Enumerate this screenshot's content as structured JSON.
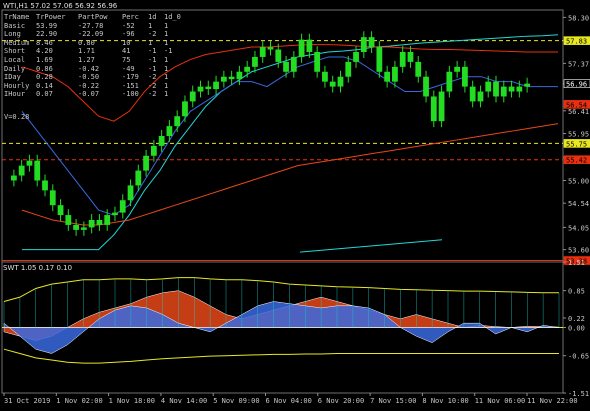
{
  "window": {
    "title": "WTI,H1  57.02 57.06 56.92 56.96",
    "indicator_title": "SWT 1.05 0.17 0.10"
  },
  "info_table": {
    "headers": [
      "TrName",
      "TrPower",
      "PartPow",
      "Perc",
      "1d",
      "1d_0"
    ],
    "rows": [
      [
        "Basic",
        "53.99",
        "-27.78",
        "-52",
        "1",
        "1"
      ],
      [
        "Long",
        "22.90",
        "-22.09",
        "-96",
        "-2",
        "1"
      ],
      [
        "Medium",
        "8.46",
        "0.80",
        "10",
        "1",
        "1"
      ],
      [
        "Short",
        "4.20",
        "1.71",
        "41",
        "-1",
        "-1"
      ],
      [
        "Local",
        "1.69",
        "1.27",
        "75",
        "-1",
        "1"
      ],
      [
        "Daily",
        "0.86",
        "-0.42",
        "-49",
        "-1",
        "1"
      ],
      [
        "IDay",
        "0.28",
        "-0.50",
        "-179",
        "-2",
        "1"
      ],
      [
        "Hourly",
        "0.14",
        "-0.22",
        "-151",
        "-2",
        "1"
      ],
      [
        "IHour",
        "0.07",
        "-0.07",
        "-100",
        "-2",
        "1"
      ]
    ],
    "v_value": "V=0.28"
  },
  "chart_data": [
    {
      "type": "candlestick",
      "title": "WTI,H1",
      "ylim": [
        53.35,
        58.45
      ],
      "y_ticks": [
        "58.30",
        "57.83",
        "57.37",
        "56.96",
        "56.41",
        "55.95",
        "55.46",
        "55.00",
        "54.54",
        "54.05",
        "53.60"
      ],
      "price_tags": [
        {
          "value": 57.83,
          "label": "57.83",
          "color": "#e8e820"
        },
        {
          "value": 56.96,
          "label": "56.96",
          "color": "#000000"
        },
        {
          "value": 56.54,
          "label": "56.54",
          "color": "#e83010"
        },
        {
          "value": 55.75,
          "label": "55.75",
          "color": "#e8e820"
        },
        {
          "value": 55.42,
          "label": "55.42",
          "color": "#e83010"
        },
        {
          "value": 53.38,
          "label": "53.38",
          "color": "#e83010"
        }
      ],
      "horizontal_lines": [
        {
          "value": 57.83,
          "style": "dashed",
          "color": "#e8e820"
        },
        {
          "value": 55.75,
          "style": "dashed",
          "color": "#e8e820"
        },
        {
          "value": 55.42,
          "style": "dashed",
          "color": "#e83010"
        },
        {
          "value": 53.38,
          "style": "solid",
          "color": "#e83010"
        }
      ],
      "candle_color": "#22dd22",
      "closes": [
        55.1,
        55.3,
        55.4,
        55.0,
        54.8,
        54.5,
        54.3,
        54.1,
        54.0,
        54.05,
        54.2,
        54.1,
        54.3,
        54.35,
        54.6,
        54.9,
        55.2,
        55.5,
        55.7,
        55.9,
        56.1,
        56.3,
        56.6,
        56.8,
        56.9,
        56.85,
        57.0,
        57.1,
        57.05,
        57.2,
        57.3,
        57.5,
        57.7,
        57.65,
        57.4,
        57.2,
        57.5,
        57.85,
        57.6,
        57.2,
        57.0,
        56.9,
        57.1,
        57.4,
        57.6,
        57.9,
        57.7,
        57.2,
        57.0,
        57.3,
        57.6,
        57.4,
        57.1,
        56.7,
        56.2,
        56.8,
        57.2,
        57.3,
        56.9,
        56.6,
        56.8,
        57.0,
        56.7,
        56.9,
        56.8,
        56.9,
        56.96
      ],
      "series": [
        {
          "name": "",
          "color": "#22d8d8",
          "values": [
            53.6,
            53.6,
            53.6,
            53.6,
            53.6,
            53.6,
            53.9,
            54.3,
            54.8,
            55.2,
            55.7,
            56.1,
            56.5,
            56.8,
            57.0,
            57.2,
            57.3,
            57.4,
            57.5,
            57.55,
            57.6,
            57.62,
            57.65,
            57.7,
            57.72,
            57.75,
            57.78,
            57.8,
            57.82,
            57.84,
            57.86,
            57.88,
            57.9,
            57.92,
            57.93,
            57.95
          ]
        },
        {
          "name": "",
          "color": "#e84818",
          "values": [
            54.4,
            54.3,
            54.2,
            54.15,
            54.1,
            54.1,
            54.15,
            54.2,
            54.3,
            54.4,
            54.5,
            54.6,
            54.7,
            54.8,
            54.9,
            55.0,
            55.1,
            55.2,
            55.3,
            55.35,
            55.4,
            55.45,
            55.5,
            55.55,
            55.6,
            55.65,
            55.7,
            55.75,
            55.8,
            55.85,
            55.9,
            55.95,
            56.0,
            56.05,
            56.1,
            56.15
          ]
        },
        {
          "name": "",
          "color": "#e83010",
          "values": [
            57.3,
            57.2,
            57.1,
            56.9,
            56.6,
            56.3,
            56.2,
            56.4,
            56.8,
            57.1,
            57.3,
            57.45,
            57.55,
            57.6,
            57.65,
            57.7,
            57.7,
            57.72,
            57.74,
            57.75,
            57.75,
            57.74,
            57.72,
            57.7,
            57.7,
            57.68,
            57.66,
            57.65,
            57.65,
            57.64,
            57.63,
            57.62,
            57.61,
            57.6,
            57.6,
            57.6
          ]
        },
        {
          "name": "",
          "color": "#3a6ae0",
          "values": [
            56.4,
            56.0,
            55.6,
            55.2,
            54.8,
            54.4,
            54.3,
            54.5,
            55.0,
            55.5,
            56.0,
            56.4,
            56.6,
            56.8,
            57.0,
            57.0,
            56.9,
            57.1,
            57.3,
            57.4,
            57.5,
            57.5,
            57.4,
            57.2,
            57.0,
            56.8,
            56.8,
            56.9,
            57.0,
            57.1,
            57.1,
            57.0,
            57.0,
            56.9,
            56.9,
            56.9
          ]
        }
      ],
      "lower_cyan_trend": {
        "from": 53.55,
        "to": 53.8
      }
    },
    {
      "type": "area",
      "title": "SWT 1.05 0.17 0.10",
      "ylim": [
        -1.51,
        1.51
      ],
      "y_ticks": [
        "1.51",
        "0.85",
        "0.22",
        "0.00",
        "-0.65",
        "-1.51"
      ],
      "series": [
        {
          "name": "",
          "color": "#e84818",
          "values": [
            -0.1,
            -0.2,
            -0.3,
            -0.2,
            0.0,
            0.2,
            0.35,
            0.45,
            0.55,
            0.7,
            0.8,
            0.85,
            0.7,
            0.5,
            0.3,
            0.2,
            0.3,
            0.4,
            0.5,
            0.6,
            0.7,
            0.6,
            0.5,
            0.4,
            0.3,
            0.2,
            0.3,
            0.2,
            0.1,
            0.0,
            0.05,
            0.02,
            0.0,
            0.03,
            0.02,
            0.01
          ]
        },
        {
          "name": "",
          "color": "#3a6ae0",
          "values": [
            0.1,
            -0.2,
            -0.5,
            -0.6,
            -0.4,
            -0.1,
            0.2,
            0.4,
            0.5,
            0.45,
            0.3,
            0.1,
            0.0,
            -0.1,
            0.1,
            0.3,
            0.5,
            0.6,
            0.55,
            0.5,
            0.45,
            0.5,
            0.5,
            0.45,
            0.3,
            0.0,
            -0.2,
            -0.35,
            -0.1,
            0.1,
            0.1,
            -0.15,
            0.0,
            -0.1,
            0.05,
            0.0
          ]
        }
      ],
      "band_upper": [
        0.6,
        0.7,
        0.9,
        1.0,
        1.05,
        1.1,
        1.1,
        1.12,
        1.12,
        1.1,
        1.12,
        1.15,
        1.15,
        1.12,
        1.1,
        1.1,
        1.08,
        1.05,
        1.0,
        0.98,
        0.96,
        0.94,
        0.93,
        0.92,
        0.9,
        0.88,
        0.87,
        0.86,
        0.85,
        0.84,
        0.84,
        0.83,
        0.82,
        0.81,
        0.8,
        0.8
      ],
      "band_lower": [
        -0.5,
        -0.6,
        -0.7,
        -0.75,
        -0.8,
        -0.82,
        -0.82,
        -0.8,
        -0.78,
        -0.75,
        -0.72,
        -0.7,
        -0.68,
        -0.66,
        -0.65,
        -0.64,
        -0.63,
        -0.62,
        -0.62,
        -0.61,
        -0.61,
        -0.6,
        -0.6,
        -0.6,
        -0.6,
        -0.6,
        -0.6,
        -0.6,
        -0.6,
        -0.6,
        -0.6,
        -0.6,
        -0.6,
        -0.6,
        -0.6,
        -0.6
      ],
      "zero_line_color": "#e8e820"
    }
  ],
  "x_axis": {
    "labels": [
      "31 Oct 2019",
      "1 Nov 02:00",
      "1 Nov 18:00",
      "4 Nov 14:00",
      "5 Nov 09:00",
      "6 Nov 04:00",
      "6 Nov 20:00",
      "7 Nov 15:00",
      "8 Nov 10:00",
      "11 Nov 06:00",
      "11 Nov 22:00"
    ]
  }
}
